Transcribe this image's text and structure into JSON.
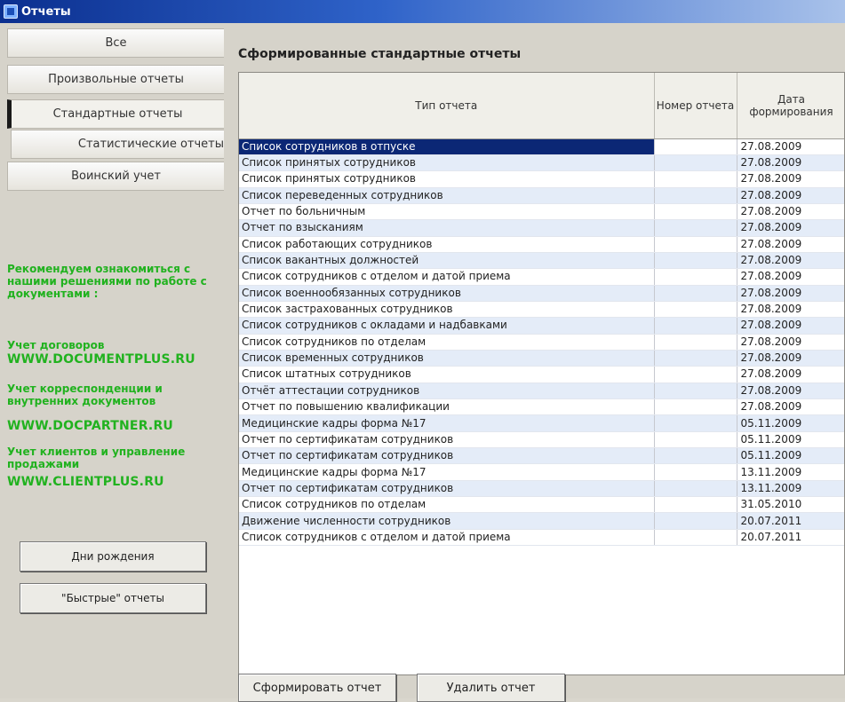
{
  "window": {
    "title": "Отчеты"
  },
  "sidebar": {
    "tabs": [
      {
        "label": "Все"
      },
      {
        "label": "Произвольные отчеты"
      },
      {
        "label": "Стандартные отчеты"
      },
      {
        "label": "Статистические отчеты"
      },
      {
        "label": "Воинский учет"
      }
    ],
    "promo_intro": "Рекомендуем ознакомиться с нашими решениями по работе с документами :",
    "promos": [
      {
        "title": "Учет договоров",
        "url": "WWW.DOCUMENTPLUS.RU"
      },
      {
        "title": "Учет корреспонденции и внутренних документов",
        "url": "WWW.DOCPARTNER.RU"
      },
      {
        "title": "Учет клиентов и управление продажами",
        "url": "WWW.CLIENTPLUS.RU"
      }
    ],
    "birthdays_button": "Дни рождения",
    "quick_button": "\"Быстрые\" отчеты"
  },
  "main": {
    "heading": "Сформированные стандартные отчеты",
    "columns": [
      "Тип отчета",
      "Номер отчета",
      "Дата формирования"
    ],
    "rows": [
      {
        "type": "Список сотрудников в отпуске",
        "number": "",
        "date": "27.08.2009"
      },
      {
        "type": "Список принятых сотрудников",
        "number": "",
        "date": "27.08.2009"
      },
      {
        "type": "Список принятых сотрудников",
        "number": "",
        "date": "27.08.2009"
      },
      {
        "type": "Список переведенных сотрудников",
        "number": "",
        "date": "27.08.2009"
      },
      {
        "type": "Отчет по больничным",
        "number": "",
        "date": "27.08.2009"
      },
      {
        "type": "Отчет по взысканиям",
        "number": "",
        "date": "27.08.2009"
      },
      {
        "type": "Список работающих сотрудников",
        "number": "",
        "date": "27.08.2009"
      },
      {
        "type": "Список вакантных должностей",
        "number": "",
        "date": "27.08.2009"
      },
      {
        "type": "Список сотрудников с отделом и датой приема",
        "number": "",
        "date": "27.08.2009"
      },
      {
        "type": "Список военнообязанных сотрудников",
        "number": "",
        "date": "27.08.2009"
      },
      {
        "type": "Список застрахованных сотрудников",
        "number": "",
        "date": "27.08.2009"
      },
      {
        "type": "Список сотрудников с окладами и надбавками",
        "number": "",
        "date": "27.08.2009"
      },
      {
        "type": "Список сотрудников по отделам",
        "number": "",
        "date": "27.08.2009"
      },
      {
        "type": "Список временных сотрудников",
        "number": "",
        "date": "27.08.2009"
      },
      {
        "type": "Список штатных сотрудников",
        "number": "",
        "date": "27.08.2009"
      },
      {
        "type": "Отчёт аттестации сотрудников",
        "number": "",
        "date": "27.08.2009"
      },
      {
        "type": "Отчет по повышению квалификации",
        "number": "",
        "date": "27.08.2009"
      },
      {
        "type": "Медицинские кадры форма №17",
        "number": "",
        "date": "05.11.2009"
      },
      {
        "type": "Отчет по сертификатам сотрудников",
        "number": "",
        "date": "05.11.2009"
      },
      {
        "type": "Отчет по сертификатам сотрудников",
        "number": "",
        "date": "05.11.2009"
      },
      {
        "type": "Медицинские кадры форма №17",
        "number": "",
        "date": "13.11.2009"
      },
      {
        "type": "Отчет по сертификатам сотрудников",
        "number": "",
        "date": "13.11.2009"
      },
      {
        "type": "Список сотрудников по отделам",
        "number": "",
        "date": "31.05.2010"
      },
      {
        "type": "Движение численности сотрудников",
        "number": "",
        "date": "20.07.2011"
      },
      {
        "type": "Список сотрудников с отделом и датой приема",
        "number": "",
        "date": "20.07.2011"
      }
    ],
    "generate_button": "Сформировать отчет",
    "delete_button": "Удалить отчет"
  }
}
